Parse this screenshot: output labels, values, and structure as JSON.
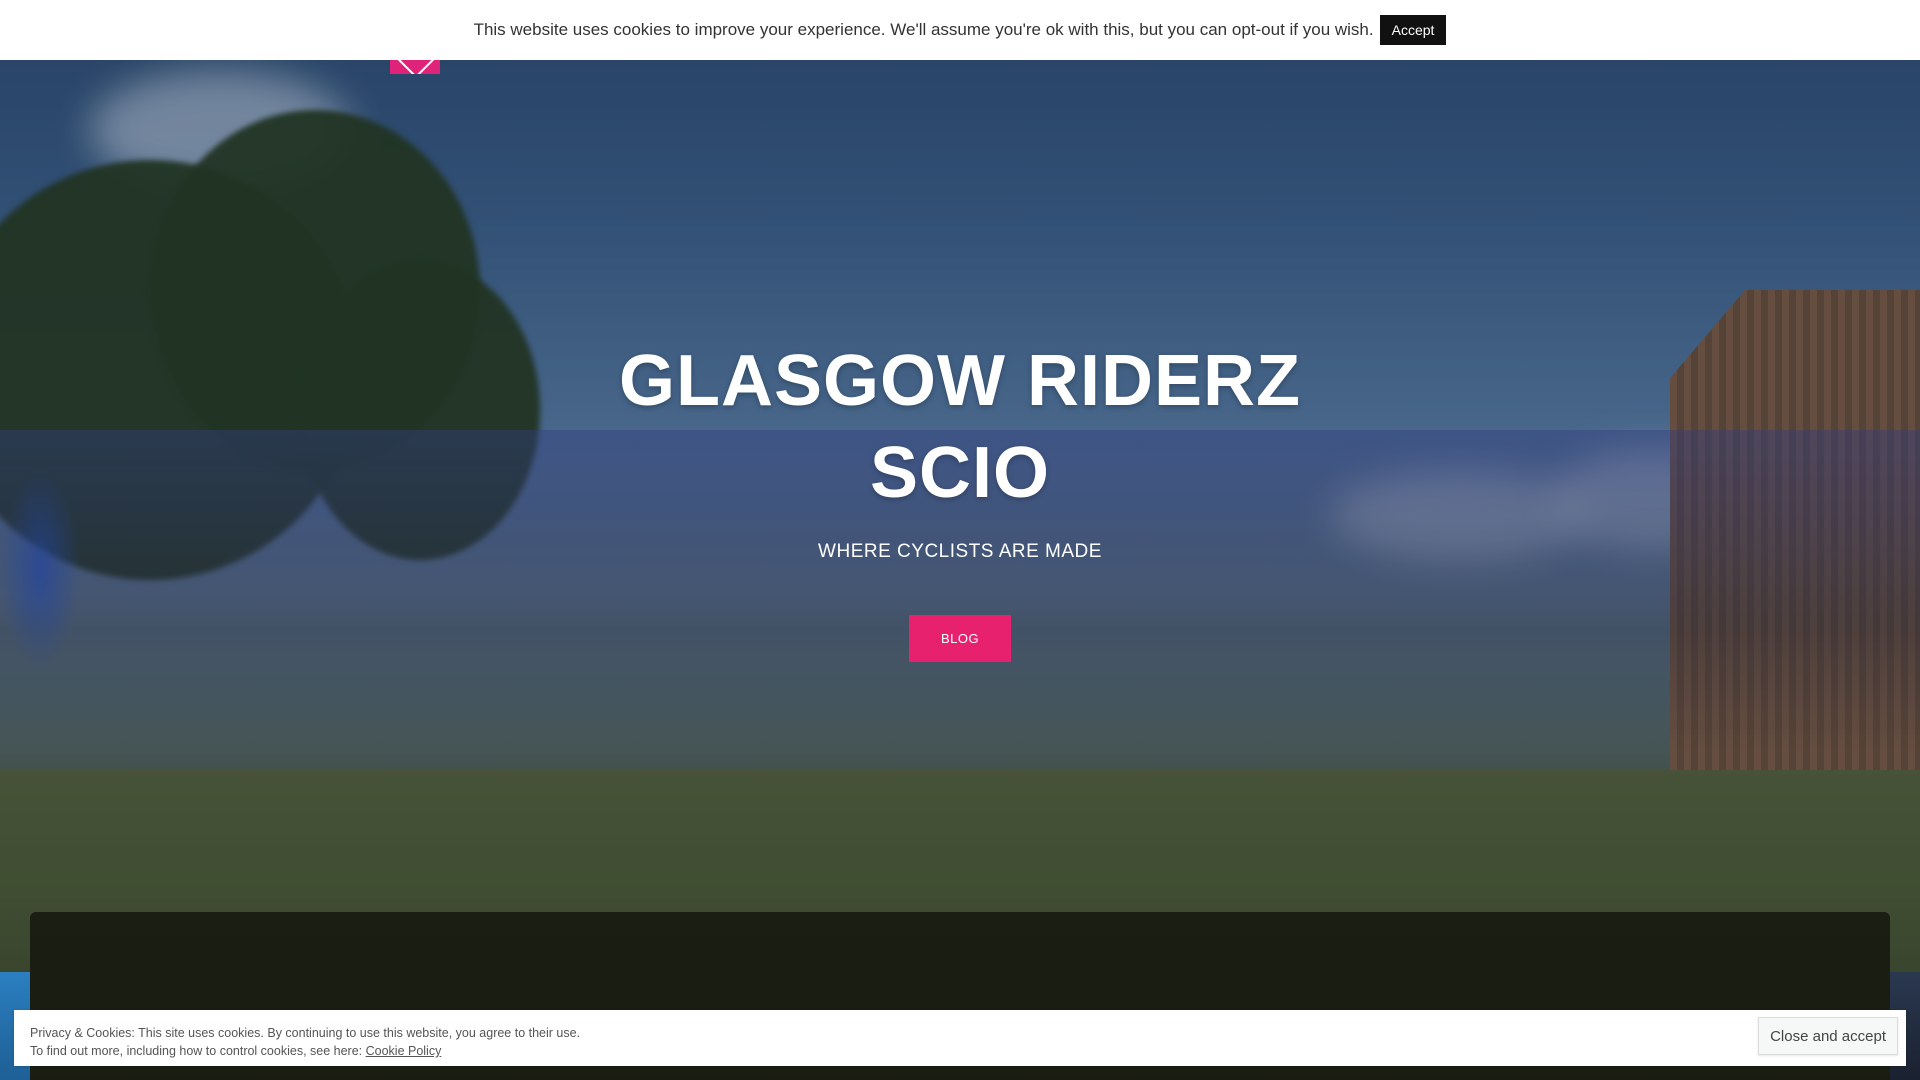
{
  "cookie_notice": {
    "text": "This website uses cookies to improve your experience. We'll assume you're ok with this, but you can opt-out if you wish.",
    "accept_label": "Accept"
  },
  "header": {
    "mail_icon": "mail-icon"
  },
  "hero": {
    "title_line1": "GLASGOW RIDERZ",
    "title_line2": "SCIO",
    "tagline": "WHERE CYCLISTS ARE MADE",
    "button_label": "BLOG"
  },
  "privacy_banner": {
    "line1": "Privacy & Cookies: This site uses cookies. By continuing to use this website, you agree to their use.",
    "line2_prefix": "To find out more, including how to control cookies, see here: ",
    "link_label": "Cookie Policy",
    "close_label": "Close and accept"
  },
  "colors": {
    "accent_pink": "#e8216f",
    "accept_button_bg": "#111111",
    "panel_bg": "#181a10"
  }
}
